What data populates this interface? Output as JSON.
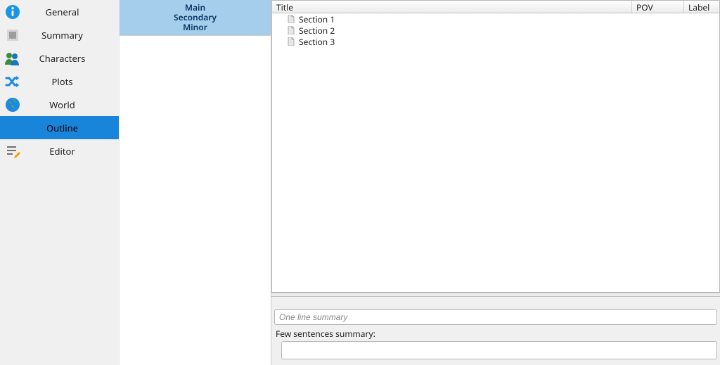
{
  "sidebar": {
    "items": [
      {
        "label": "General",
        "icon": "info-icon"
      },
      {
        "label": "Summary",
        "icon": "summary-icon"
      },
      {
        "label": "Characters",
        "icon": "people-icon"
      },
      {
        "label": "Plots",
        "icon": "shuffle-icon"
      },
      {
        "label": "World",
        "icon": "globe-icon"
      },
      {
        "label": "Outline",
        "icon": "outline-icon",
        "selected": true
      },
      {
        "label": "Editor",
        "icon": "editor-icon"
      }
    ]
  },
  "categories": {
    "lines": [
      "Main",
      "Secondary",
      "Minor"
    ]
  },
  "tree": {
    "columns": {
      "title": "Title",
      "pov": "POV",
      "label": "Label"
    },
    "rows": [
      {
        "title": "Section 1"
      },
      {
        "title": "Section 2"
      },
      {
        "title": "Section 3"
      }
    ]
  },
  "bottom": {
    "one_line_placeholder": "One line summary",
    "few_label": "Few sentences summary:"
  }
}
